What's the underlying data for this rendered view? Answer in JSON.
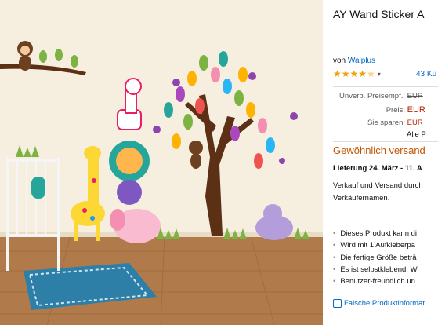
{
  "product": {
    "title": "AY Wand Sticker A",
    "by_prefix": "von",
    "brand": "Walplus",
    "rating_chevron": "▾",
    "reviews": "43 Ku"
  },
  "price": {
    "list_label": "Unverb. Preisempf.:",
    "list_value": "EUR",
    "price_label": "Preis:",
    "price_value": "EUR",
    "save_label": "Sie sparen:",
    "save_value": "EUR",
    "incl": "Alle P"
  },
  "shipping": {
    "usual": "Gewöhnlich versand",
    "delivery": "Lieferung 24. März - 11. A",
    "desc_line1": "Verkauf und Versand durch",
    "desc_line2": "Verkäufernamen."
  },
  "features": [
    "Dieses Produkt kann di",
    "Wird mit 1 Aufkleberpa",
    "Die fertige Größe beträ",
    "Es ist selbstklebend, W",
    "Benutzer-freundlich un"
  ],
  "report_link": "Falsche Produktinformat",
  "colors": {
    "link": "#0066c0",
    "price": "#b12704",
    "availability": "#c45500",
    "star": "#f0a000"
  },
  "rating_value": 4.5
}
